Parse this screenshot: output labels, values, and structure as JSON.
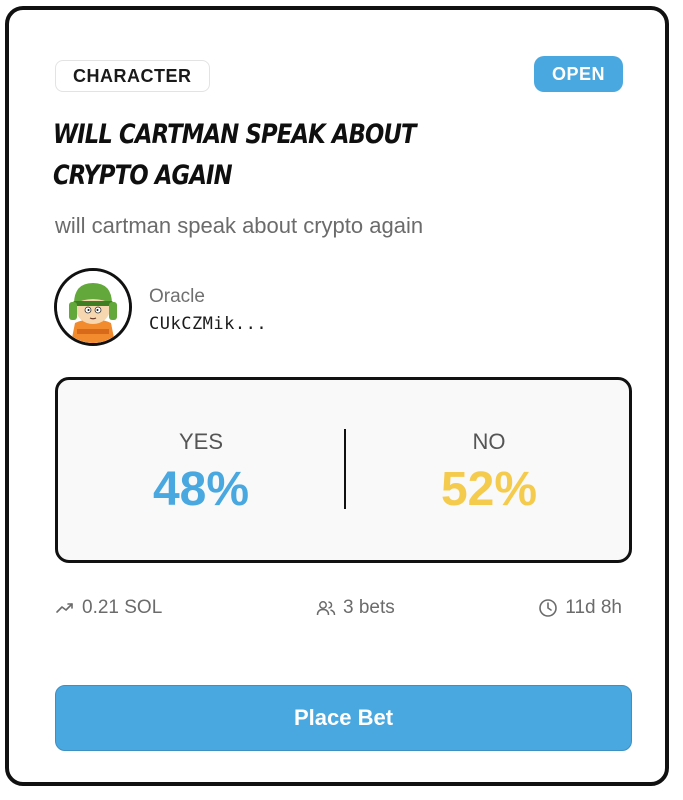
{
  "market": {
    "category": "CHARACTER",
    "status": "OPEN",
    "title": "WILL CARTMAN SPEAK ABOUT CRYPTO AGAIN",
    "description": "will cartman speak about crypto again"
  },
  "oracle": {
    "label": "Oracle",
    "address": "CUkCZMik..."
  },
  "odds": {
    "yes_label": "YES",
    "yes_pct": "48%",
    "no_label": "NO",
    "no_pct": "52%"
  },
  "stats": {
    "volume": "0.21 SOL",
    "bets": "3 bets",
    "time_left": "11d 8h"
  },
  "actions": {
    "place_bet_label": "Place Bet"
  },
  "colors": {
    "accent": "#4aa8e0",
    "yes": "#4aa8e0",
    "no": "#f5cb4d"
  },
  "icons": {
    "volume": "trending-up-icon",
    "bets": "users-icon",
    "time": "clock-icon"
  }
}
